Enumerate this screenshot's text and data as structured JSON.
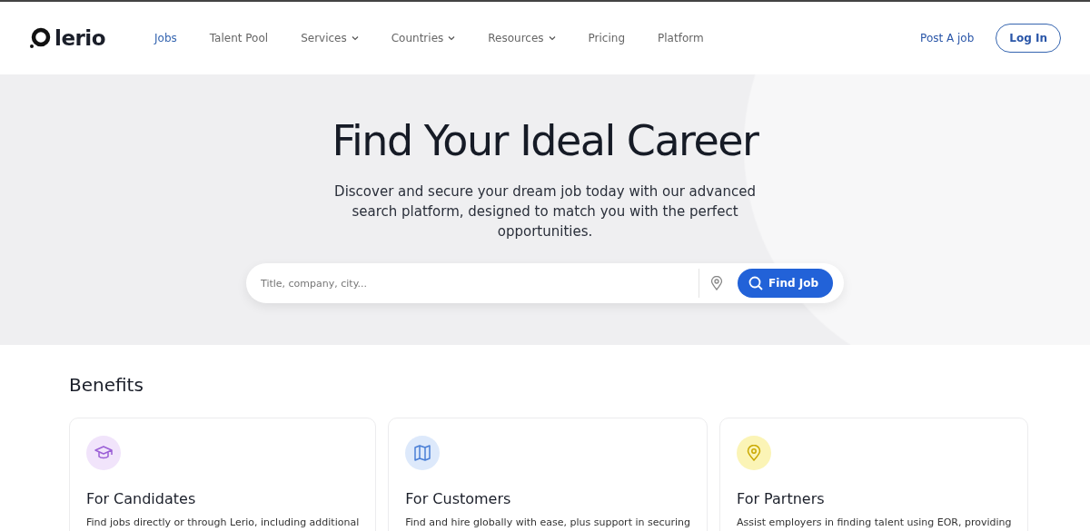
{
  "brand": {
    "name": "lerio"
  },
  "nav": [
    {
      "label": "Jobs",
      "selected": true,
      "dropdown": false
    },
    {
      "label": "Talent Pool",
      "selected": false,
      "dropdown": false
    },
    {
      "label": "Services",
      "selected": false,
      "dropdown": true
    },
    {
      "label": "Countries",
      "selected": false,
      "dropdown": true
    },
    {
      "label": "Resources",
      "selected": false,
      "dropdown": true
    },
    {
      "label": "Pricing",
      "selected": false,
      "dropdown": false
    },
    {
      "label": "Platform",
      "selected": false,
      "dropdown": false
    }
  ],
  "header_actions": {
    "post_job": "Post A job",
    "login": "Log In"
  },
  "hero": {
    "title": "Find Your Ideal Career",
    "subtitle": "Discover and secure your dream job today with our advanced search platform, designed to match you with the perfect opportunities.",
    "search": {
      "placeholder": "Title, company, city...",
      "button": "Find Job"
    }
  },
  "benefits": {
    "heading": "Benefits",
    "cards": [
      {
        "kind": "cap",
        "color": "#f1e4fb",
        "title": "For Candidates",
        "text": "Find jobs directly or through Lerio, including additional"
      },
      {
        "kind": "map",
        "color": "#dde9fb",
        "title": "For Customers",
        "text": "Find and hire globally with ease, plus support in securing"
      },
      {
        "kind": "pin",
        "color": "#fbf4b6",
        "title": "For Partners",
        "text": "Assist employers in finding talent using EOR, providing"
      }
    ]
  }
}
